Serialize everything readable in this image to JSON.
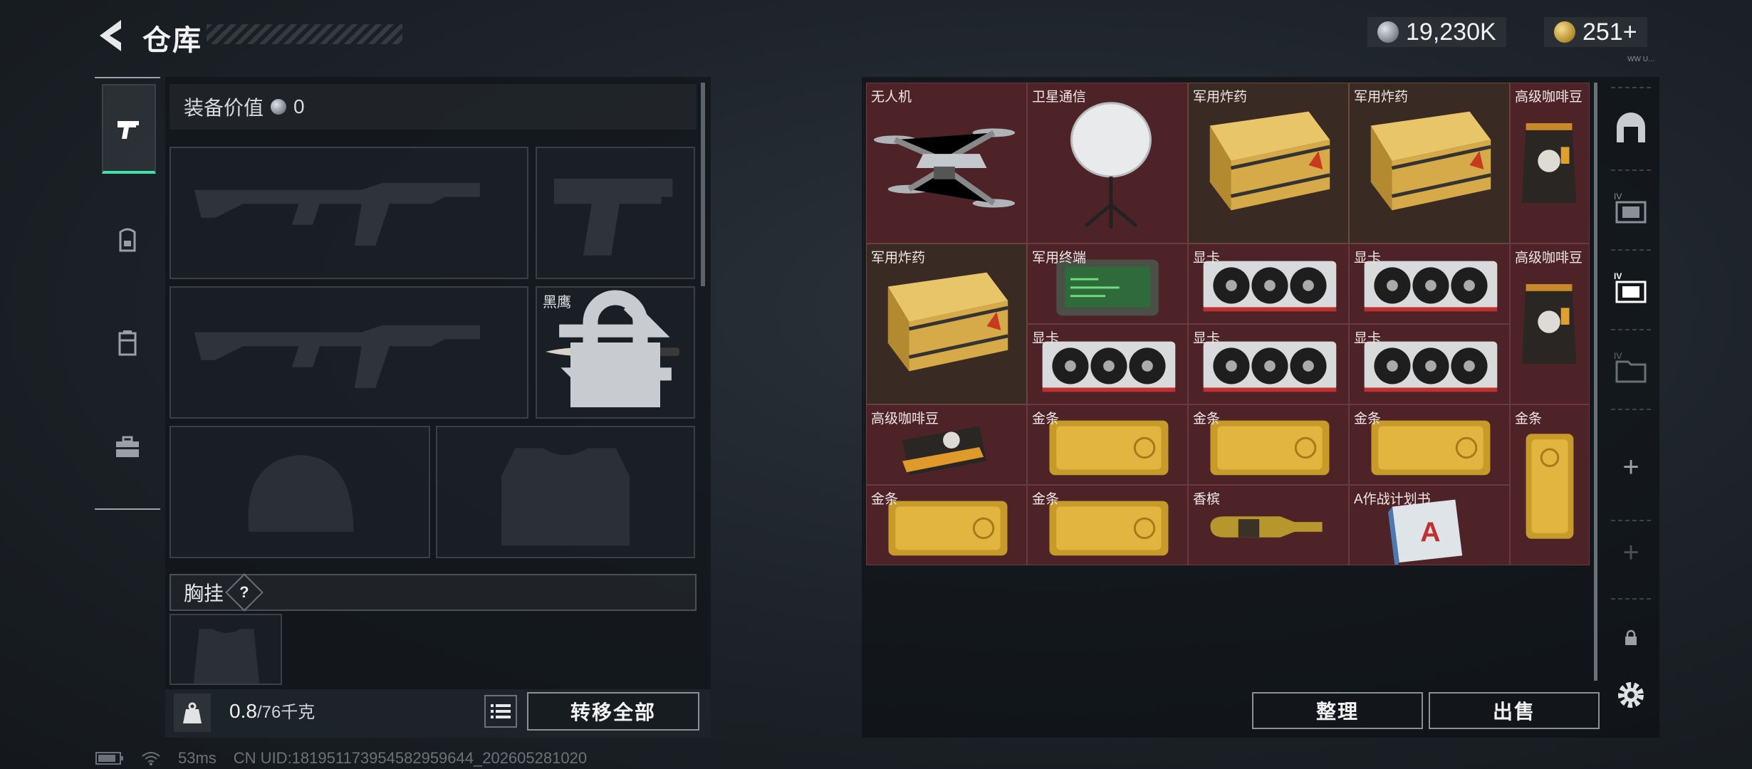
{
  "header": {
    "title": "仓库",
    "currency_silver": "19,230K",
    "currency_gold": "251+",
    "tiny_tag": "WW U…"
  },
  "categories": [
    {
      "name": "weapons",
      "icon": "pistol-icon"
    },
    {
      "name": "gear",
      "icon": "backpack-icon"
    },
    {
      "name": "containers",
      "icon": "storage-icon"
    },
    {
      "name": "medkit",
      "icon": "toolbox-icon"
    }
  ],
  "equipment": {
    "value_label": "装备价值",
    "value": "0",
    "knife_slot_label": "黑鹰",
    "vest_label": "胸挂",
    "vest_help": "?"
  },
  "weight": {
    "current": "0.8",
    "max": "/76千克"
  },
  "buttons": {
    "transfer_all": "转移全部",
    "sort": "整理",
    "sell": "出售"
  },
  "stash_items": [
    {
      "label": "无人机",
      "item": "drone"
    },
    {
      "label": "卫星通信",
      "item": "satellite-dish"
    },
    {
      "label": "军用炸药",
      "item": "explosive-crate"
    },
    {
      "label": "军用炸药",
      "item": "explosive-crate"
    },
    {
      "label": "高级咖啡豆",
      "item": "coffee-bag"
    },
    {
      "label": "军用炸药",
      "item": "explosive-crate"
    },
    {
      "label": "军用终端",
      "item": "military-terminal"
    },
    {
      "label": "显卡",
      "item": "graphics-card"
    },
    {
      "label": "显卡",
      "item": "graphics-card"
    },
    {
      "label": "高级咖啡豆",
      "item": "coffee-bag"
    },
    {
      "label": "显卡",
      "item": "graphics-card"
    },
    {
      "label": "显卡",
      "item": "graphics-card"
    },
    {
      "label": "显卡",
      "item": "graphics-card"
    },
    {
      "label": "高级咖啡豆",
      "item": "coffee-bag"
    },
    {
      "label": "金条",
      "item": "gold-bar"
    },
    {
      "label": "金条",
      "item": "gold-bar"
    },
    {
      "label": "金条",
      "item": "gold-bar"
    },
    {
      "label": "金条",
      "item": "gold-bar"
    },
    {
      "label": "金条",
      "item": "gold-bar"
    },
    {
      "label": "金条",
      "item": "gold-bar"
    },
    {
      "label": "香槟",
      "item": "champagne"
    },
    {
      "label": "A作战计划书",
      "item": "plan-book"
    }
  ],
  "status_bar": {
    "ping": "53ms",
    "uid": "CN UID:18195117395458295964​4_202605281020"
  },
  "colors": {
    "accent_green": "#3ee3a8",
    "stash_cell": "#4e2328",
    "gold_cell": "#3a2a24"
  }
}
